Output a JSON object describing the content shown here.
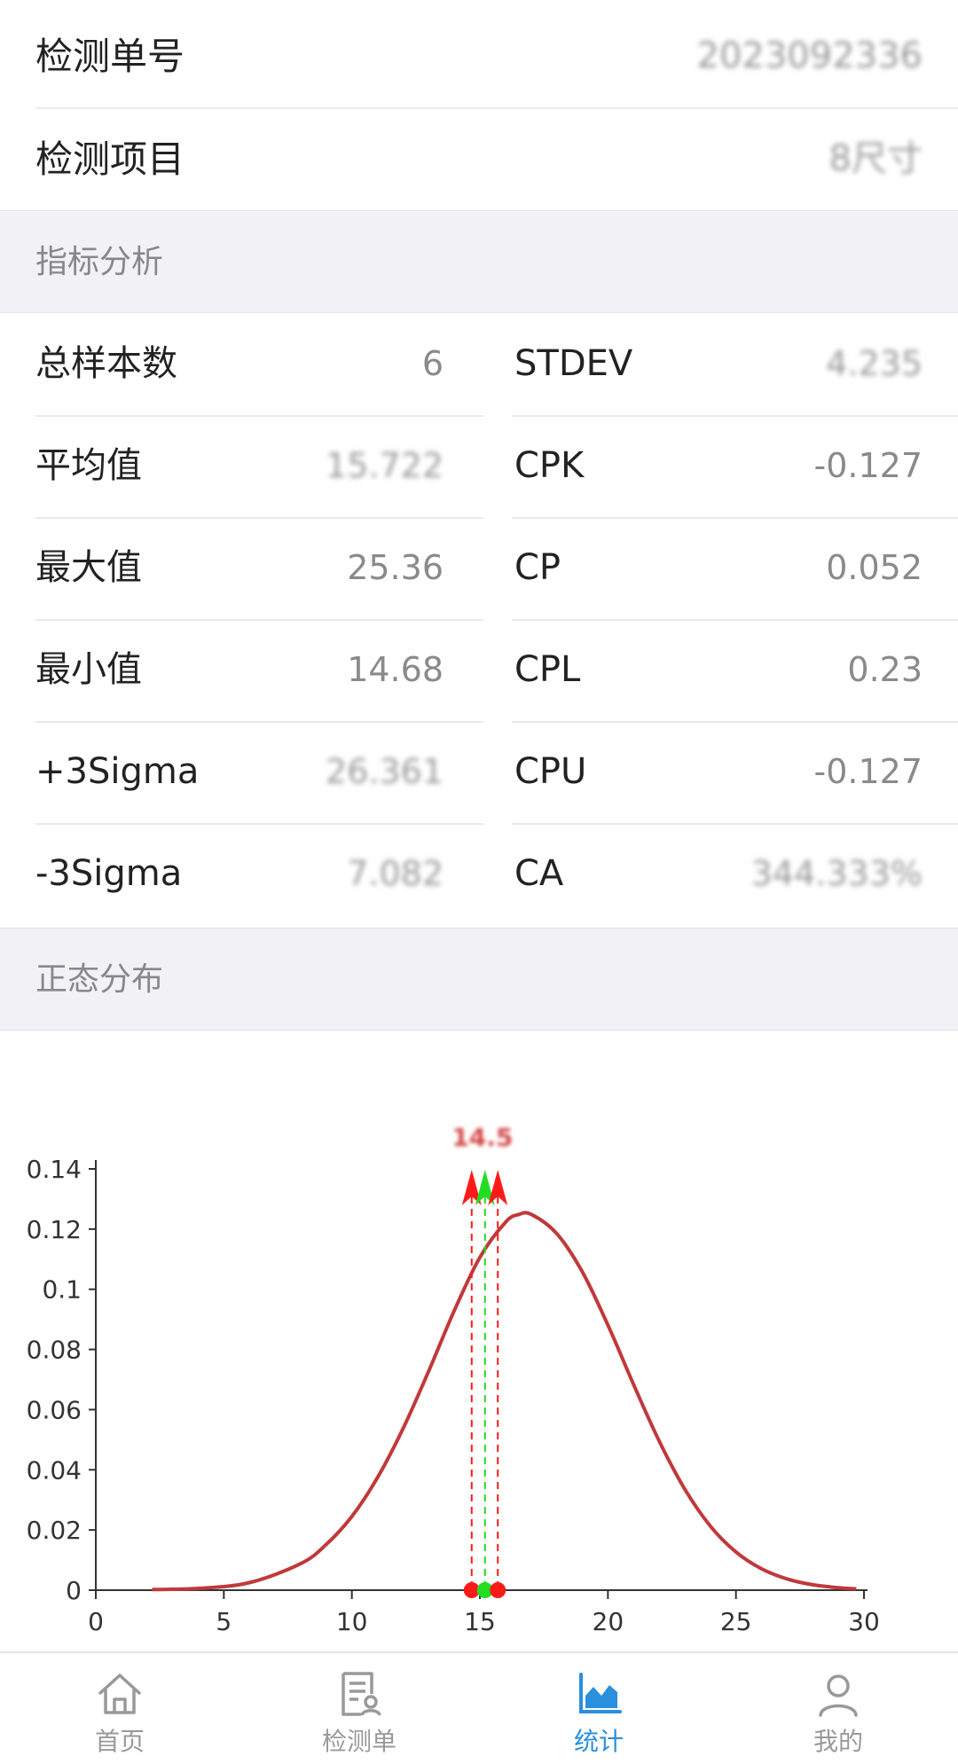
{
  "info": {
    "order_no_label": "检测单号",
    "order_no_value": "2023092336",
    "item_label": "检测项目",
    "item_value": "8尺寸"
  },
  "indicator_section_title": "指标分析",
  "metrics_left": [
    {
      "label": "总样本数",
      "value": "6"
    },
    {
      "label": "平均值",
      "value": "15.722"
    },
    {
      "label": "最大值",
      "value": "25.36"
    },
    {
      "label": "最小值",
      "value": "14.68"
    },
    {
      "label": "+3Sigma",
      "value": "26.361"
    },
    {
      "label": "-3Sigma",
      "value": "7.082"
    }
  ],
  "metrics_right": [
    {
      "label": "STDEV",
      "value": "4.235"
    },
    {
      "label": "CPK",
      "value": "-0.127"
    },
    {
      "label": "CP",
      "value": "0.052"
    },
    {
      "label": "CPL",
      "value": "0.23"
    },
    {
      "label": "CPU",
      "value": "-0.127"
    },
    {
      "label": "CA",
      "value": "344.333%"
    }
  ],
  "distribution_section_title": "正态分布",
  "chart_data": {
    "type": "line",
    "title": "",
    "xlabel": "",
    "ylabel": "",
    "xlim": [
      0,
      30
    ],
    "ylim": [
      0,
      0.14
    ],
    "x_ticks": [
      "0",
      "5",
      "10",
      "15",
      "20",
      "25",
      "30"
    ],
    "y_ticks": [
      "0",
      "0.02",
      "0.04",
      "0.06",
      "0.08",
      "0.1",
      "0.12",
      "0.14"
    ],
    "curve": {
      "color": "#c0393b",
      "x": [
        2.2,
        4,
        6,
        8,
        9,
        10,
        11,
        12,
        13,
        14,
        15,
        16,
        16.5,
        17,
        18,
        19,
        20,
        21,
        22,
        23,
        24,
        25,
        26,
        27,
        28,
        29,
        29.7
      ],
      "y": [
        0.0002,
        0.0006,
        0.0025,
        0.0088,
        0.0152,
        0.0245,
        0.0374,
        0.0537,
        0.0728,
        0.0929,
        0.1106,
        0.1223,
        0.1248,
        0.1249,
        0.1185,
        0.1058,
        0.0881,
        0.0684,
        0.0496,
        0.0336,
        0.0213,
        0.0127,
        0.0071,
        0.0037,
        0.0018,
        0.0008,
        0.0004
      ]
    },
    "markers": [
      {
        "x": 14.68,
        "color": "#ff1a1a"
      },
      {
        "x": 15.2,
        "color": "#22dd22"
      },
      {
        "x": 15.7,
        "color": "#ff1a1a"
      }
    ],
    "marker_label": "14.5",
    "marker_label_color": "#d44444"
  },
  "tabbar": [
    {
      "label": "首页",
      "icon": "home-icon",
      "active": false
    },
    {
      "label": "检测单",
      "icon": "inspection-doc-icon",
      "active": false
    },
    {
      "label": "统计",
      "icon": "chart-icon",
      "active": true
    },
    {
      "label": "我的",
      "icon": "user-icon",
      "active": false
    }
  ],
  "colors": {
    "accent": "#2a8fdc",
    "curve": "#c0393b",
    "marker_red": "#ff1a1a",
    "marker_green": "#22dd22"
  }
}
